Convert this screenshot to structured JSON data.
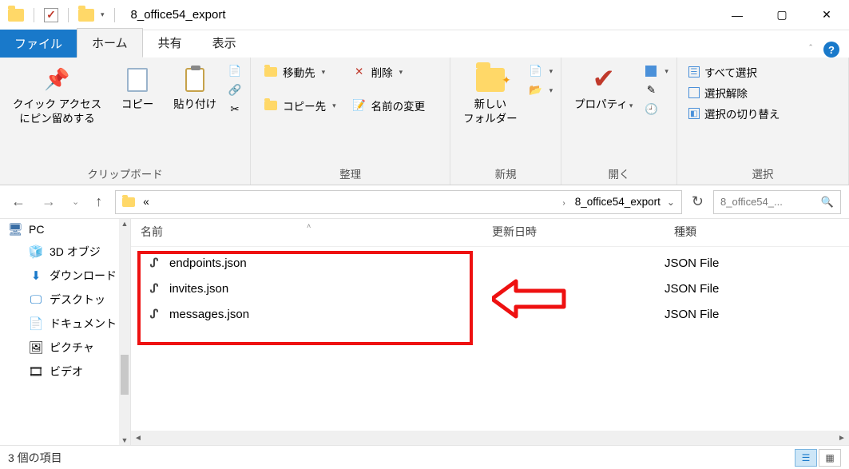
{
  "window": {
    "title": "8_office54_export"
  },
  "tabs": {
    "file": "ファイル",
    "home": "ホーム",
    "share": "共有",
    "view": "表示"
  },
  "ribbon": {
    "clipboard": {
      "label": "クリップボード",
      "pin": "クイック アクセス\nにピン留めする",
      "copy": "コピー",
      "paste": "貼り付け"
    },
    "organize": {
      "label": "整理",
      "moveto": "移動先",
      "copyto": "コピー先",
      "delete": "削除",
      "rename": "名前の変更"
    },
    "new": {
      "label": "新規",
      "newfolder": "新しい\nフォルダー"
    },
    "open": {
      "label": "開く",
      "properties": "プロパティ"
    },
    "select": {
      "label": "選択",
      "all": "すべて選択",
      "none": "選択解除",
      "invert": "選択の切り替え"
    }
  },
  "address": {
    "crumb_root": "«",
    "crumb_current": "8_office54_export"
  },
  "search": {
    "placeholder": "8_office54_..."
  },
  "sidebar": {
    "pc": "PC",
    "items": [
      "3D オブジ",
      "ダウンロード",
      "デスクトッ",
      "ドキュメント",
      "ピクチャ",
      "ビデオ"
    ]
  },
  "columns": {
    "name": "名前",
    "date": "更新日時",
    "type": "種類"
  },
  "files": [
    {
      "name": "endpoints.json",
      "type": "JSON File"
    },
    {
      "name": "invites.json",
      "type": "JSON File"
    },
    {
      "name": "messages.json",
      "type": "JSON File"
    }
  ],
  "status": {
    "text": "3 個の項目"
  }
}
